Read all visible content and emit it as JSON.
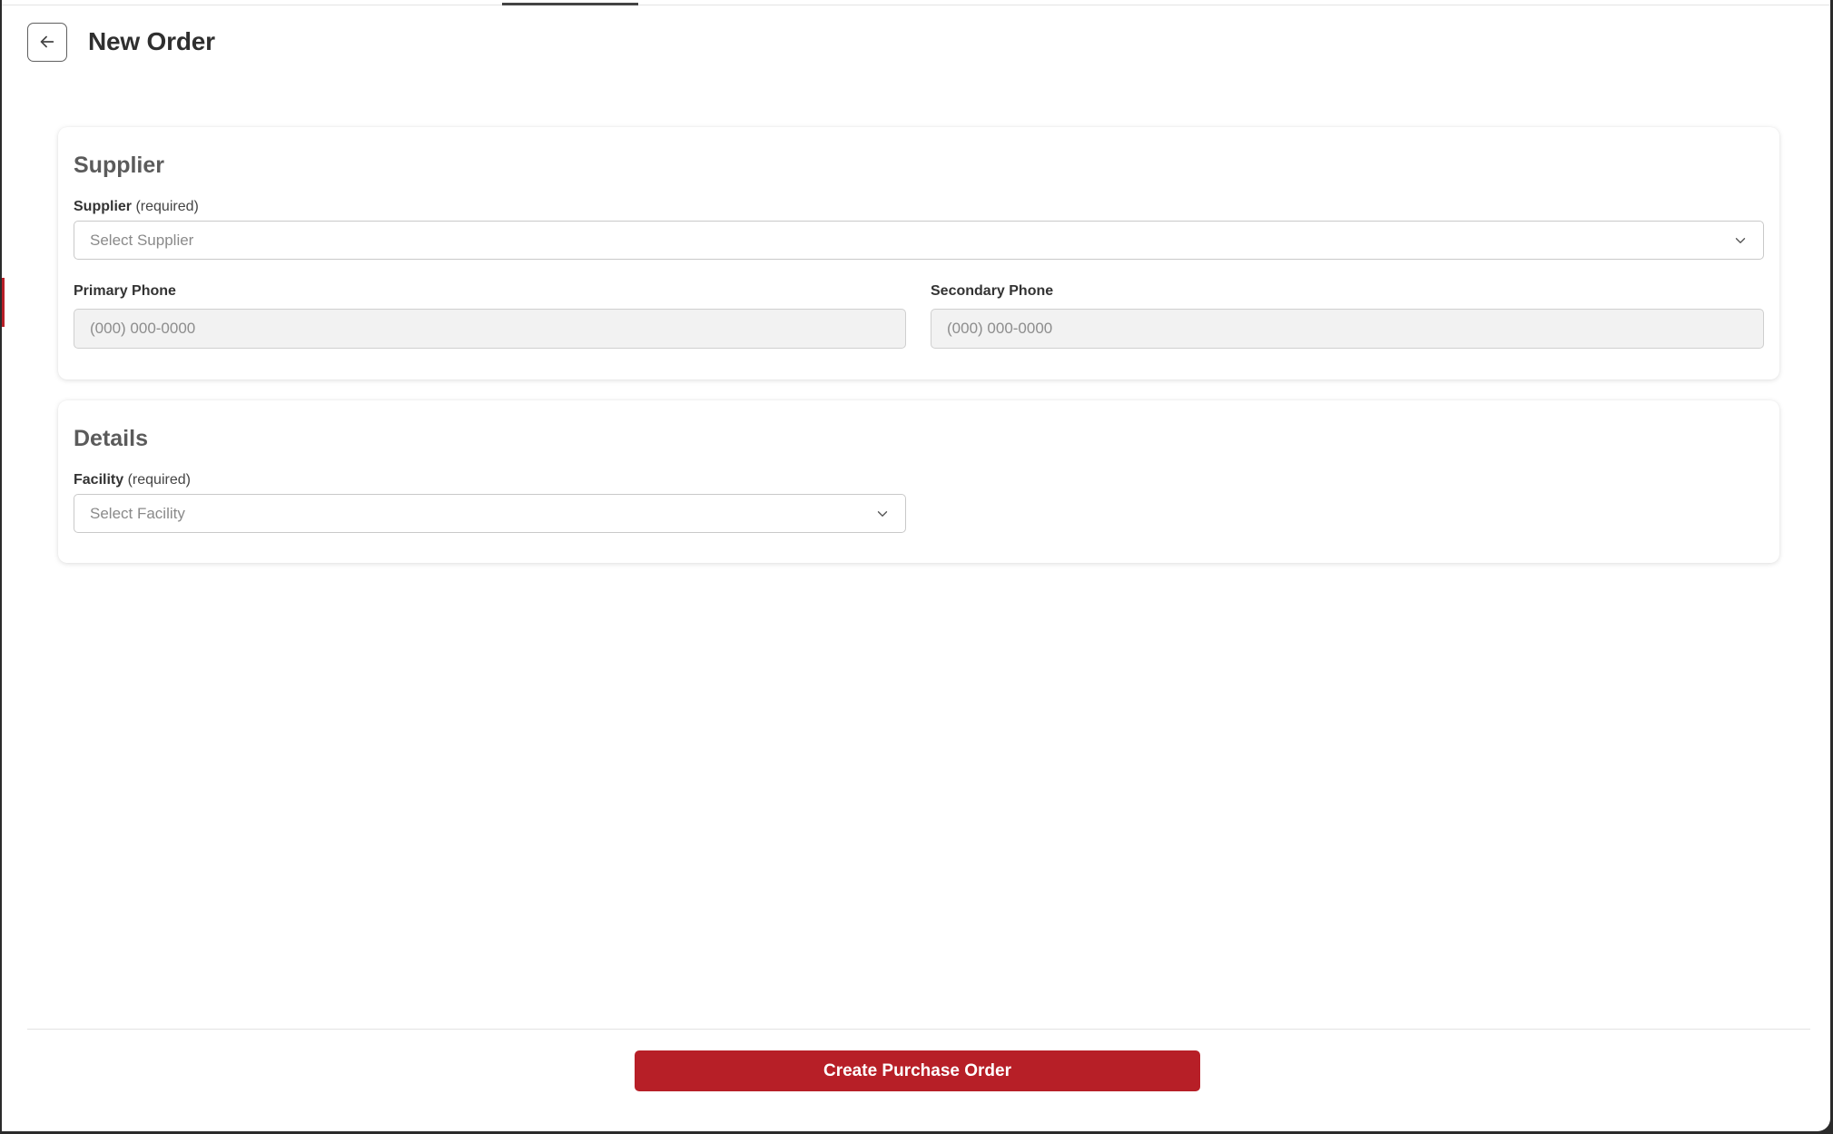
{
  "header": {
    "title": "New Order",
    "back_icon": "arrow-left-icon"
  },
  "supplier_section": {
    "title": "Supplier",
    "supplier_label": "Supplier",
    "supplier_required": "(required)",
    "supplier_placeholder": "Select Supplier",
    "primary_phone_label": "Primary Phone",
    "primary_phone_placeholder": "(000) 000-0000",
    "secondary_phone_label": "Secondary Phone",
    "secondary_phone_placeholder": "(000) 000-0000"
  },
  "details_section": {
    "title": "Details",
    "facility_label": "Facility",
    "facility_required": "(required)",
    "facility_placeholder": "Select Facility"
  },
  "footer": {
    "submit_label": "Create Purchase Order"
  },
  "colors": {
    "accent": "#b71f27",
    "input_disabled_bg": "#f2f2f2"
  }
}
